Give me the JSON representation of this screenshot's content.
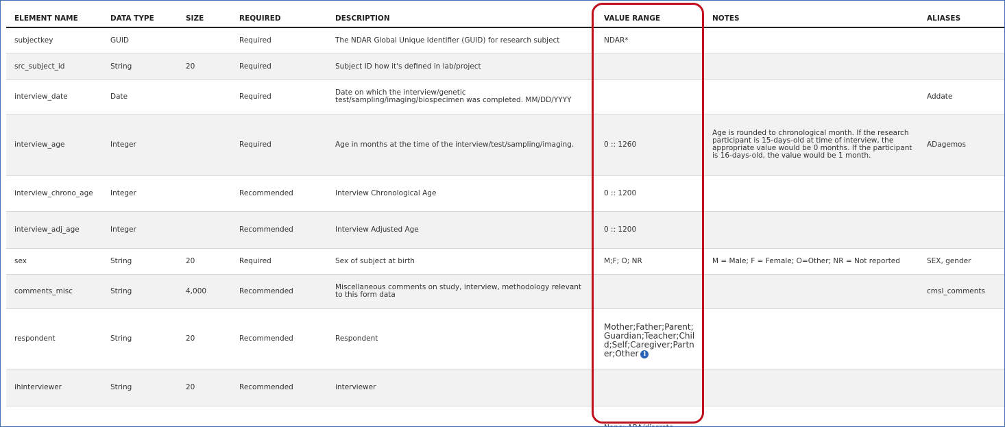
{
  "columns": [
    {
      "key": "element_name",
      "label": "ELEMENT NAME"
    },
    {
      "key": "data_type",
      "label": "DATA TYPE"
    },
    {
      "key": "size",
      "label": "SIZE"
    },
    {
      "key": "required",
      "label": "REQUIRED"
    },
    {
      "key": "description",
      "label": "DESCRIPTION"
    },
    {
      "key": "value_range",
      "label": "VALUE RANGE"
    },
    {
      "key": "notes",
      "label": "NOTES"
    },
    {
      "key": "aliases",
      "label": "ALIASES"
    }
  ],
  "rows": [
    {
      "element_name": "subjectkey",
      "data_type": "GUID",
      "size": "",
      "required": "Required",
      "description": "The NDAR Global Unique Identifier (GUID) for research subject",
      "value_range": "NDAR*",
      "notes": "",
      "aliases": ""
    },
    {
      "element_name": "src_subject_id",
      "data_type": "String",
      "size": "20",
      "required": "Required",
      "description": "Subject ID how it's defined in lab/project",
      "value_range": "",
      "notes": "",
      "aliases": ""
    },
    {
      "element_name": "interview_date",
      "data_type": "Date",
      "size": "",
      "required": "Required",
      "description": "Date on which the interview/genetic test/sampling/imaging/biospecimen was completed. MM/DD/YYYY",
      "value_range": "",
      "notes": "",
      "aliases": "Addate"
    },
    {
      "element_name": "interview_age",
      "data_type": "Integer",
      "size": "",
      "required": "Required",
      "description": "Age in months at the time of the interview/test/sampling/imaging.",
      "value_range": "0 :: 1260",
      "notes": "Age is rounded to chronological month. If the research participant is 15-days-old at time of interview, the appropriate value would be 0 months. If the participant is 16-days-old, the value would be 1 month.",
      "aliases": "ADagemos"
    },
    {
      "element_name": "interview_chrono_age",
      "data_type": "Integer",
      "size": "",
      "required": "Recommended",
      "description": "Interview Chronological Age",
      "value_range": "0 :: 1200",
      "notes": "",
      "aliases": ""
    },
    {
      "element_name": "interview_adj_age",
      "data_type": "Integer",
      "size": "",
      "required": "Recommended",
      "description": "Interview Adjusted Age",
      "value_range": "0 :: 1200",
      "notes": "",
      "aliases": ""
    },
    {
      "element_name": "sex",
      "data_type": "String",
      "size": "20",
      "required": "Required",
      "description": "Sex of subject at birth",
      "value_range": "M;F; O; NR",
      "notes": "M = Male; F = Female; O=Other; NR = Not reported",
      "aliases": "SEX, gender"
    },
    {
      "element_name": "comments_misc",
      "data_type": "String",
      "size": "4,000",
      "required": "Recommended",
      "description": "Miscellaneous comments on study, interview, methodology relevant to this form data",
      "value_range": "",
      "notes": "",
      "aliases": "cmsl_comments"
    },
    {
      "element_name": "respondent",
      "data_type": "String",
      "size": "20",
      "required": "Recommended",
      "description": "Respondent",
      "value_range": "Mother;Father;Parent;Guardian;Teacher;Child;Self;Caregiver;Partner;Other",
      "notes": "",
      "aliases": ""
    },
    {
      "element_name": "ihinterviewer",
      "data_type": "String",
      "size": "20",
      "required": "Recommended",
      "description": "interviewer",
      "value_range": "",
      "notes": "",
      "aliases": ""
    },
    {
      "element_name": "",
      "data_type": "",
      "size": "",
      "required": "",
      "description": "",
      "value_range": "None; ABA/discrete",
      "notes": "",
      "aliases": ""
    }
  ],
  "value_range_info_icon": "info-circle-icon",
  "colors": {
    "header_rule": "#222222",
    "row_alt": "#f2f2f2",
    "highlight": "#c0101e",
    "frame_border": "#3b6fb6",
    "info_icon": "#2a63b5"
  }
}
